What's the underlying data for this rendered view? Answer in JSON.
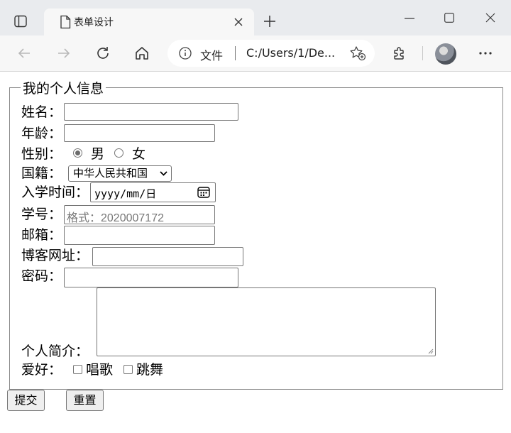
{
  "browser": {
    "tab": {
      "title": "表单设计"
    },
    "address": {
      "scheme_label": "文件",
      "url": "C:/Users/1/De..."
    }
  },
  "form": {
    "legend": "我的个人信息",
    "name": {
      "label": "姓名：",
      "value": ""
    },
    "age": {
      "label": "年龄：",
      "value": ""
    },
    "gender": {
      "label": "性别：",
      "options": [
        "男",
        "女"
      ],
      "selected": "男"
    },
    "nationality": {
      "label": "国籍：",
      "selected": "中华人民共和国"
    },
    "enroll_date": {
      "label": "入学时间：",
      "placeholder": "yyyy/mm/日"
    },
    "student_id": {
      "label": "学号：",
      "placeholder": "格式：2020007172"
    },
    "email": {
      "label": "邮箱：",
      "value": ""
    },
    "blog": {
      "label": "博客网址：",
      "value": ""
    },
    "password": {
      "label": "密码：",
      "value": ""
    },
    "bio": {
      "label": "个人简介：",
      "value": ""
    },
    "hobbies": {
      "label": "爱好：",
      "options": [
        "唱歌",
        "跳舞"
      ]
    },
    "submit_label": "提交",
    "reset_label": "重置"
  }
}
